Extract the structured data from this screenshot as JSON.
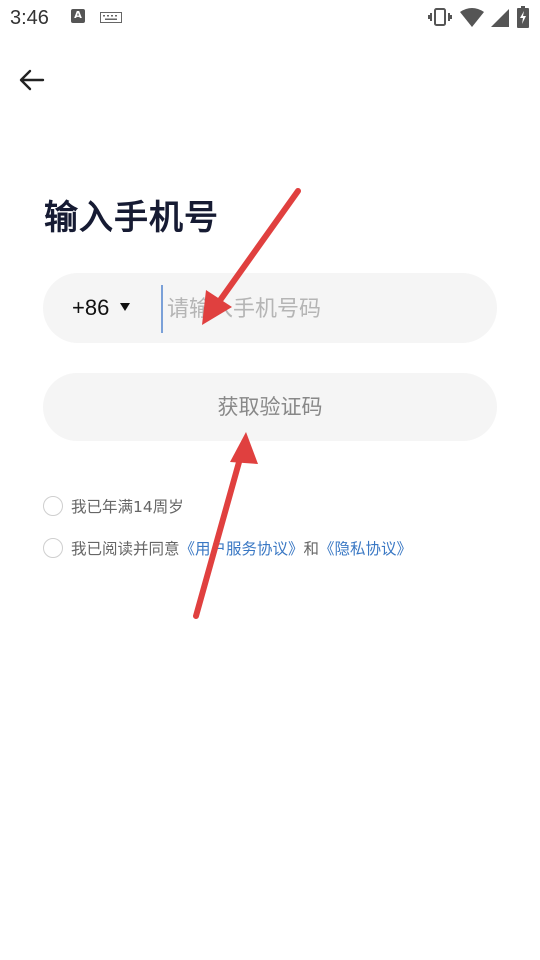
{
  "status_bar": {
    "time": "3:46",
    "a_badge": "A",
    "icons": [
      "text-a-icon",
      "keyboard-icon",
      "vibrate-icon",
      "wifi-icon",
      "cell-signal-icon",
      "battery-charging-icon"
    ]
  },
  "header": {
    "back_icon": "arrow-left-icon"
  },
  "title": "输入手机号",
  "phone": {
    "country_code": "+86",
    "caret": "▼",
    "placeholder": "请输入手机号码",
    "value": ""
  },
  "get_code_label": "获取验证码",
  "agreements": {
    "age": {
      "label": "我已年满14周岁"
    },
    "terms": {
      "prefix": "我已阅读并同意",
      "user_agreement": "《用户服务协议》",
      "and": "和",
      "privacy_policy": "《隐私协议》"
    }
  },
  "colors": {
    "accent_link": "#3a78c4",
    "title": "#161b33",
    "field_bg": "#f5f5f5",
    "annotation_arrow": "#e0403f"
  }
}
